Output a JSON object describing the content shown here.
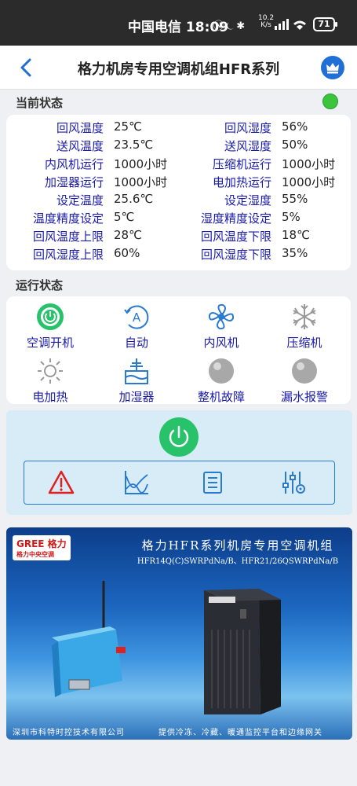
{
  "status_bar": {
    "carrier_time": "中国电信 18:09",
    "speed_value": "10.2",
    "speed_unit": "K/s",
    "battery": "71"
  },
  "header": {
    "title": "格力机房专用空调机组HFR系列"
  },
  "current_status": {
    "title": "当前状态",
    "indicator_color": "#3cc43c",
    "rows": [
      {
        "l_label": "回风温度",
        "l_value": "25℃",
        "r_label": "回风湿度",
        "r_value": "56%"
      },
      {
        "l_label": "送风温度",
        "l_value": "23.5℃",
        "r_label": "送风湿度",
        "r_value": "50%"
      },
      {
        "l_label": "内风机运行",
        "l_value": "1000小时",
        "r_label": "压缩机运行",
        "r_value": "1000小时"
      },
      {
        "l_label": "加湿器运行",
        "l_value": "1000小时",
        "r_label": "电加热运行",
        "r_value": "1000小时"
      },
      {
        "l_label": "设定温度",
        "l_value": "25.6℃",
        "r_label": "设定湿度",
        "r_value": "55%"
      },
      {
        "l_label": "温度精度设定",
        "l_value": "5℃",
        "r_label": "湿度精度设定",
        "r_value": "5%"
      },
      {
        "l_label": "回风温度上限",
        "l_value": "28℃",
        "r_label": "回风温度下限",
        "r_value": "18℃"
      },
      {
        "l_label": "回风湿度上限",
        "l_value": "60%",
        "r_label": "回风湿度下限",
        "r_value": "35%"
      }
    ]
  },
  "run_status": {
    "title": "运行状态",
    "items": [
      {
        "label": "空调开机",
        "icon": "power-on-icon"
      },
      {
        "label": "自动",
        "icon": "auto-mode-icon"
      },
      {
        "label": "内风机",
        "icon": "fan-icon"
      },
      {
        "label": "压缩机",
        "icon": "snowflake-icon"
      },
      {
        "label": "电加热",
        "icon": "heater-sun-icon"
      },
      {
        "label": "加湿器",
        "icon": "humidifier-icon"
      },
      {
        "label": "整机故障",
        "icon": "fault-indicator-icon"
      },
      {
        "label": "漏水报警",
        "icon": "leak-alarm-indicator-icon"
      }
    ]
  },
  "controls": {
    "power_icon": "power-icon",
    "tools": [
      "alarm-warning-icon",
      "trend-chart-icon",
      "list-document-icon",
      "settings-sliders-icon"
    ]
  },
  "banner": {
    "logo_main": "GREE 格力",
    "logo_sub": "格力中央空调",
    "title": "格力HFR系列机房专用空调机组",
    "models": "HFR14Q(C)SWRPdNa/B、HFR21/26QSWRPdNa/B",
    "footer_left": "深圳市科特时控技术有限公司",
    "footer_right": "提供冷冻、冷藏、暖通监控平台和边缘网关"
  },
  "colors": {
    "label": "#1a1aa8",
    "accent": "#1f6fd6",
    "power_green": "#27c26a",
    "alarm_red": "#e02020",
    "tool_blue": "#2a7ad0"
  }
}
